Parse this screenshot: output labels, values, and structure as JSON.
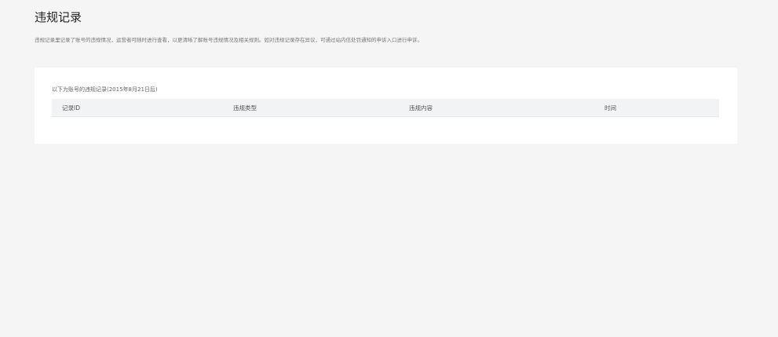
{
  "page": {
    "title": "违规记录",
    "description": "违规记录里记录了账号的违规情况，运营者可随时进行查看，以更清晰了解账号违规情况及相关规则。如对违规记录存在异议，可通过站内信处罚通知的申诉入口进行申诉。"
  },
  "records": {
    "caption": "以下为账号的违规记录(2015年8月21日后)",
    "columns": [
      "记录ID",
      "违规类型",
      "违规内容",
      "时间"
    ],
    "rows": []
  }
}
